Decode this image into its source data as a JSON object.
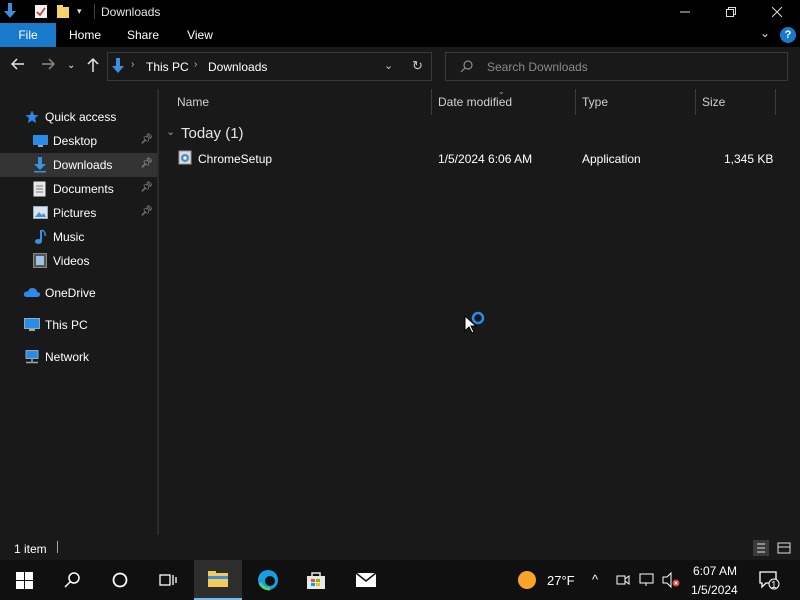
{
  "window": {
    "title": "Downloads"
  },
  "ribbon": {
    "tabs": [
      "File",
      "Home",
      "Share",
      "View"
    ]
  },
  "address": {
    "crumbs": [
      "This PC",
      "Downloads"
    ]
  },
  "search": {
    "placeholder": "Search Downloads"
  },
  "nav": {
    "items": [
      {
        "label": "Quick access",
        "icon": "star-icon"
      },
      {
        "label": "Desktop",
        "icon": "desktop-icon",
        "pinned": true
      },
      {
        "label": "Downloads",
        "icon": "download-icon",
        "pinned": true,
        "selected": true
      },
      {
        "label": "Documents",
        "icon": "document-icon",
        "pinned": true
      },
      {
        "label": "Pictures",
        "icon": "picture-icon",
        "pinned": true
      },
      {
        "label": "Music",
        "icon": "music-icon"
      },
      {
        "label": "Videos",
        "icon": "video-icon"
      },
      {
        "label": "OneDrive",
        "icon": "cloud-icon"
      },
      {
        "label": "This PC",
        "icon": "computer-icon"
      },
      {
        "label": "Network",
        "icon": "network-icon"
      }
    ]
  },
  "columns": [
    "Name",
    "Date modified",
    "Type",
    "Size"
  ],
  "group": {
    "header": "Today (1)"
  },
  "files": [
    {
      "name": "ChromeSetup",
      "date": "1/5/2024 6:06 AM",
      "type": "Application",
      "size": "1,345 KB"
    }
  ],
  "status": {
    "count": "1 item"
  },
  "taskbar": {
    "weather": "27°F",
    "time": "6:07 AM",
    "date": "1/5/2024",
    "notification_count": "1"
  },
  "colors": {
    "accent": "#1979ca",
    "background": "#191919",
    "selection": "#333333"
  }
}
